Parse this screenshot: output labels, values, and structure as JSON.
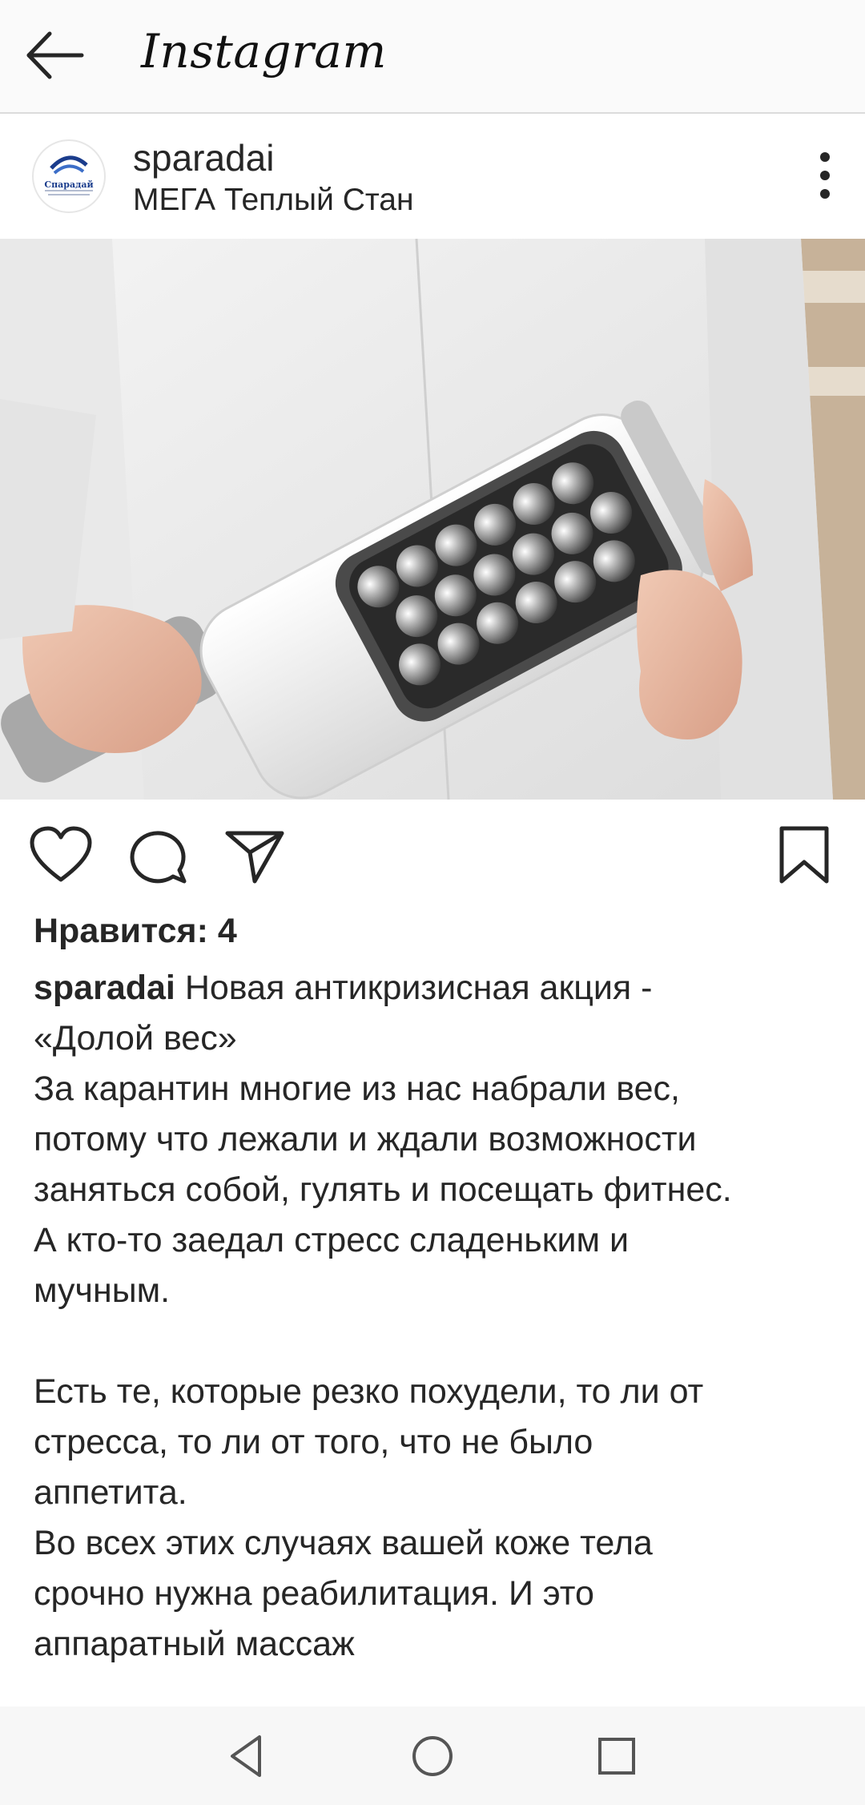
{
  "app_bar": {
    "title": "Instagram",
    "back_icon": "arrow-left-icon"
  },
  "post": {
    "username": "sparadai",
    "location": "МЕГА Теплый Стан",
    "avatar_text": "Спарадай",
    "more_icon": "more-vertical-icon",
    "image_description_icon": "massage-roller-photo",
    "actions": {
      "like_icon": "heart-icon",
      "comment_icon": "comment-icon",
      "share_icon": "send-icon",
      "save_icon": "bookmark-icon"
    },
    "likes_label": "Нравится: 4",
    "caption": {
      "username": "sparadai",
      "first_line": "Новая антикризисная акция -",
      "lines_a": [
        "«Долой вес»",
        "За карантин многие из нас набрали вес,",
        "потому что лежали и ждали возможности",
        "заняться собой, гулять и посещать фитнес.",
        "А кто-то заедал стресс сладеньким и",
        "мучным."
      ],
      "lines_b": [
        "Есть те, которые резко похудели, то ли от",
        "стресса, то ли от того, что не было",
        "аппетита.",
        "Во всех этих случаях вашей коже тела",
        "срочно нужна реабилитация. И это",
        "аппаратный массаж"
      ]
    }
  },
  "nav_bar": {
    "back_icon": "triangle-back-icon",
    "home_icon": "circle-home-icon",
    "recents_icon": "square-recents-icon"
  },
  "colors": {
    "text": "#262626",
    "app_bar_bg": "#fafafa",
    "nav_bg": "#f7f7f7"
  }
}
